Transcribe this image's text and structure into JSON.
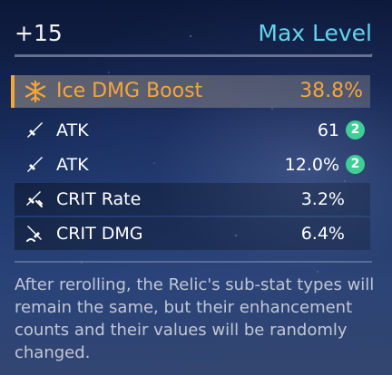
{
  "header": {
    "level": "+15",
    "max_level": "Max Level"
  },
  "main_stat": {
    "icon": "ice-snowflake-icon",
    "label": "Ice DMG Boost",
    "value": "38.8%",
    "color": "#f5a638"
  },
  "sub_stats": [
    {
      "icon": "sword-icon",
      "label": "ATK",
      "value": "61",
      "enhance_count": "2"
    },
    {
      "icon": "sword-icon",
      "label": "ATK",
      "value": "12.0%",
      "enhance_count": "2"
    },
    {
      "icon": "crit-rate-icon",
      "label": "CRIT Rate",
      "value": "3.2%",
      "enhance_count": ""
    },
    {
      "icon": "crit-dmg-icon",
      "label": "CRIT DMG",
      "value": "6.4%",
      "enhance_count": ""
    }
  ],
  "description": "After rerolling, the Relic's sub-stat types will remain the same, but their enhancement counts and their values will be randomly changed.",
  "colors": {
    "accent_cyan": "#5fd5ee",
    "main_stat_orange": "#f5a638",
    "badge_green": "#3fcf96"
  }
}
